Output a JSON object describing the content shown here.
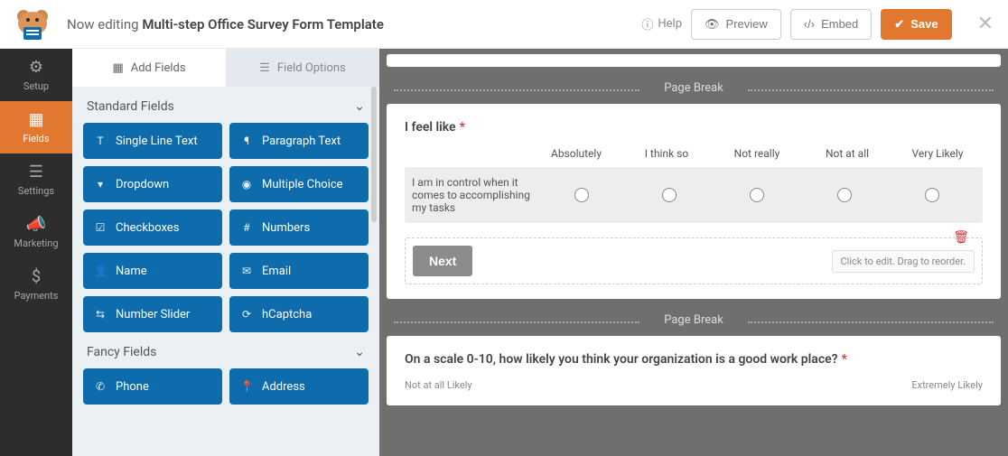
{
  "header": {
    "prefix": "Now editing",
    "title": "Multi-step Office Survey Form Template",
    "help": "Help",
    "preview": "Preview",
    "embed": "Embed",
    "save": "Save"
  },
  "nav": [
    {
      "label": "Setup",
      "icon": "⚙"
    },
    {
      "label": "Fields",
      "icon": "▦"
    },
    {
      "label": "Settings",
      "icon": "⚙"
    },
    {
      "label": "Marketing",
      "icon": "📣"
    },
    {
      "label": "Payments",
      "icon": "$"
    }
  ],
  "panel": {
    "tabs": {
      "add": "Add Fields",
      "options": "Field Options"
    },
    "standard_label": "Standard Fields",
    "standard": [
      {
        "label": "Single Line Text",
        "icon": "T"
      },
      {
        "label": "Paragraph Text",
        "icon": "¶"
      },
      {
        "label": "Dropdown",
        "icon": "▾"
      },
      {
        "label": "Multiple Choice",
        "icon": "◉"
      },
      {
        "label": "Checkboxes",
        "icon": "☑"
      },
      {
        "label": "Numbers",
        "icon": "#"
      },
      {
        "label": "Name",
        "icon": "👤"
      },
      {
        "label": "Email",
        "icon": "✉"
      },
      {
        "label": "Number Slider",
        "icon": "⇆"
      },
      {
        "label": "hCaptcha",
        "icon": "⟳"
      }
    ],
    "fancy_label": "Fancy Fields",
    "fancy": [
      {
        "label": "Phone",
        "icon": "✆"
      },
      {
        "label": "Address",
        "icon": "📍"
      }
    ]
  },
  "canvas": {
    "page_break": "Page Break",
    "q1": {
      "label": "I feel like",
      "columns": [
        "Absolutely",
        "I think so",
        "Not really",
        "Not at all",
        "Very Likely"
      ],
      "row": "I am in control when it comes to accomplishing my tasks"
    },
    "next": "Next",
    "hint": "Click to edit. Drag to reorder.",
    "q2": {
      "label": "On a scale 0-10, how likely you think your organization is a good work place?",
      "left": "Not at all Likely",
      "right": "Extremely Likely"
    }
  }
}
